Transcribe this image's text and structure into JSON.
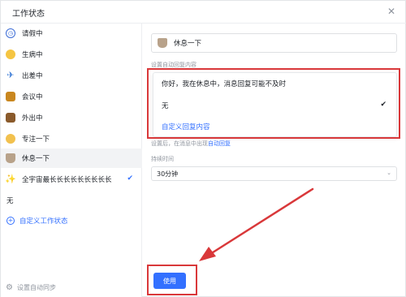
{
  "dialog": {
    "title": "工作状态"
  },
  "sidebar": {
    "items": [
      {
        "label": "请假中",
        "icon": "clock-icon"
      },
      {
        "label": "生病中",
        "icon": "sick-face-icon"
      },
      {
        "label": "出差中",
        "icon": "airplane-icon"
      },
      {
        "label": "会议中",
        "icon": "meeting-icon"
      },
      {
        "label": "外出中",
        "icon": "briefcase-icon"
      },
      {
        "label": "专注一下",
        "icon": "focus-face-icon"
      },
      {
        "label": "休息一下",
        "icon": "coffee-icon"
      },
      {
        "label": "全宇宙最长长长长长长长长长",
        "icon": "sparkle-icon"
      }
    ],
    "plain_item": "无",
    "add_label": "自定义工作状态",
    "footer_label": "设置自动同步"
  },
  "main": {
    "status_name": "休息一下",
    "auto_reply_label": "设置自动回复内容",
    "auto_reply_options": [
      "你好，我在休息中，消息回复可能不及时",
      "无",
      "自定义回复内容"
    ],
    "hint_text": "设置后，在消息中出现",
    "hint_link": "自动回复",
    "duration_label": "持续时间",
    "duration_value": "30分钟",
    "apply_label": "使用"
  },
  "colors": {
    "accent": "#3370ff",
    "highlight": "#d9383a"
  }
}
